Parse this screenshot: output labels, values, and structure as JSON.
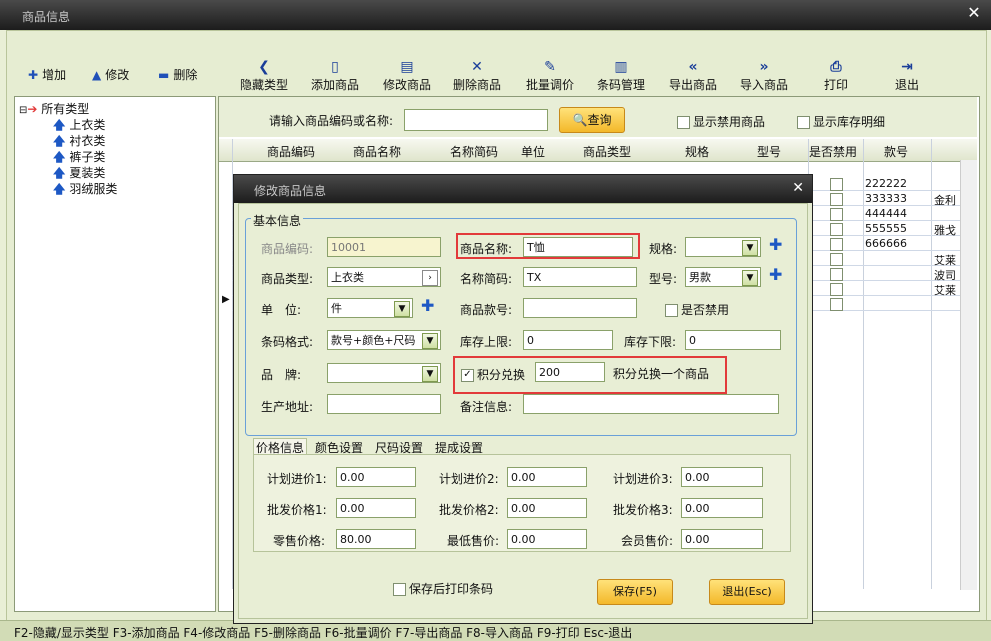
{
  "window": {
    "title": "商品信息"
  },
  "left_toolbar": {
    "add": "增加",
    "edit": "修改",
    "delete": "删除"
  },
  "toolbar": [
    "隐藏类型",
    "添加商品",
    "修改商品",
    "删除商品",
    "批量调价",
    "条码管理",
    "导出商品",
    "导入商品",
    "打印",
    "退出"
  ],
  "tree": {
    "root": "所有类型",
    "items": [
      "上衣类",
      "衬衣类",
      "裤子类",
      "夏装类",
      "羽绒服类"
    ]
  },
  "search": {
    "label": "请输入商品编码或名称:",
    "value": "",
    "query_button": "查询",
    "show_disabled": "显示禁用商品",
    "show_stock": "显示库存明细"
  },
  "grid": {
    "headers": [
      "商品编码",
      "商品名称",
      "名称简码",
      "单位",
      "商品类型",
      "规格",
      "型号",
      "是否禁用",
      "款号"
    ],
    "rows_kuanhao": [
      "222222",
      "333333",
      "444444",
      "555555",
      "666666"
    ],
    "rows_right": [
      "金利",
      "雅戈",
      "艾莱",
      "波司",
      "艾莱"
    ]
  },
  "dialog": {
    "title": "修改商品信息",
    "basic_legend": "基本信息",
    "labels": {
      "code": "商品编码:",
      "name": "商品名称:",
      "spec": "规格:",
      "type": "商品类型:",
      "abbr": "名称简码:",
      "model": "型号:",
      "unit": "单　位:",
      "style": "商品款号:",
      "disabled": "是否禁用",
      "barcode": "条码格式:",
      "stock_max": "库存上限:",
      "stock_min": "库存下限:",
      "brand": "品　牌:",
      "points": "积分兑换",
      "points_suffix": "积分兑换一个商品",
      "address": "生产地址:",
      "remark": "备注信息:"
    },
    "values": {
      "code": "10001",
      "name": "T恤",
      "spec": "",
      "type": "上衣类",
      "abbr": "TX",
      "model": "男款",
      "unit": "件",
      "style": "",
      "barcode": "款号+颜色+尺码",
      "stock_max": "0",
      "stock_min": "0",
      "brand": "",
      "points": "200",
      "address": "",
      "remark": ""
    },
    "tabs": [
      "价格信息",
      "颜色设置",
      "尺码设置",
      "提成设置"
    ],
    "price_labels": [
      "计划进价1:",
      "计划进价2:",
      "计划进价3:",
      "批发价格1:",
      "批发价格2:",
      "批发价格3:",
      "零售价格:",
      "最低售价:",
      "会员售价:"
    ],
    "price_values": [
      "0.00",
      "0.00",
      "0.00",
      "0.00",
      "0.00",
      "0.00",
      "80.00",
      "0.00",
      "0.00"
    ],
    "print_after_save": "保存后打印条码",
    "save_button": "保存(F5)",
    "exit_button": "退出(Esc)"
  },
  "statusbar": "F2-隐藏/显示类型  F3-添加商品  F4-修改商品  F5-删除商品  F6-批量调价  F7-导出商品  F8-导入商品  F9-打印  Esc-退出"
}
